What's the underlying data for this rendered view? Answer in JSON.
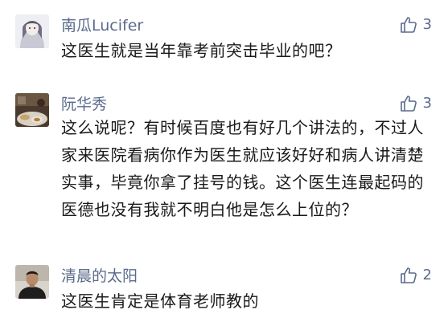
{
  "comments": [
    {
      "username": "南瓜Lucifer",
      "likes": "3",
      "text": "这医生就是当年靠考前突击毕业的吧？",
      "avatar": "avatar-illustration-girl"
    },
    {
      "username": "阮华秀",
      "likes": "3",
      "text": "这么说呢？有时候百度也有好几个讲法的，不过人家来医院看病你作为医生就应该好好和病人讲清楚实事，毕竟你拿了挂号的钱。这个医生连最起码的医德也没有我就不明白他是怎么上位的？",
      "avatar": "avatar-dining-photo"
    },
    {
      "username": "清晨的太阳",
      "likes": "2",
      "text": "这医生肯定是体育老师教的",
      "avatar": "avatar-portrait-photo"
    }
  ],
  "icons": {
    "like": "thumbs-up-icon"
  },
  "colors": {
    "username": "#5b6b8c",
    "text": "#1a1a1a",
    "background": "#ffffff"
  }
}
